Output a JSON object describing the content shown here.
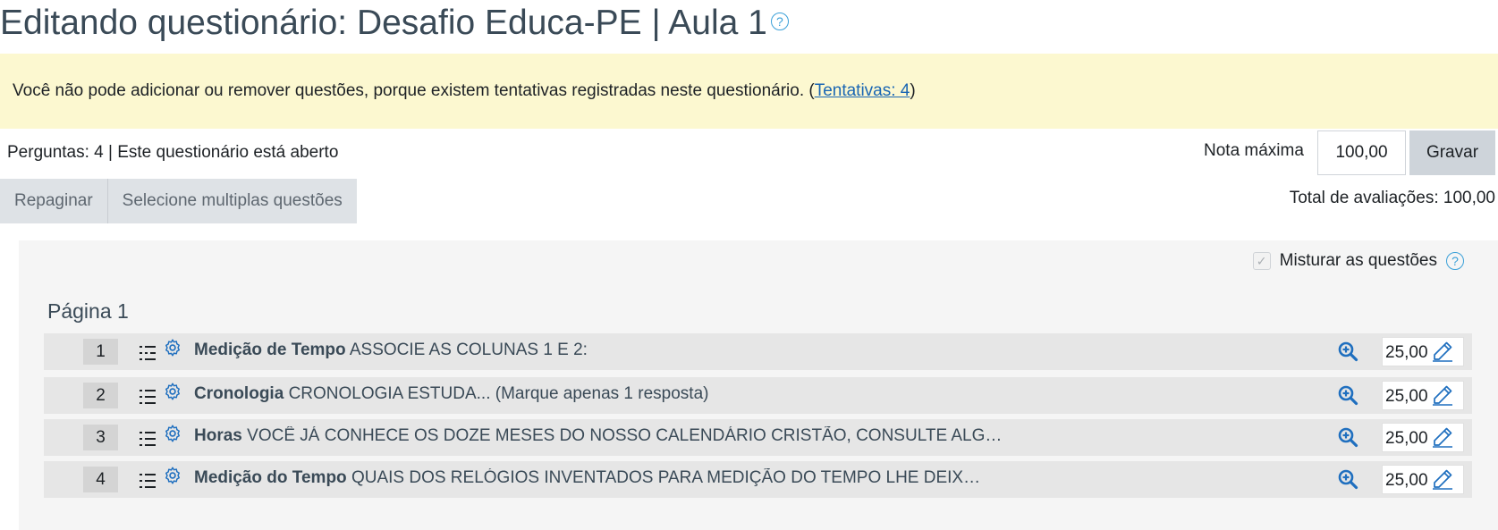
{
  "header": {
    "title": "Editando questionário: Desafio Educa-PE | Aula 1",
    "help_icon": "question-circle-icon"
  },
  "alert": {
    "message": "Você não pode adicionar ou remover questões, porque existem tentativas registradas neste questionário. (",
    "link_text": "Tentativas: 4",
    "suffix": ")"
  },
  "status": {
    "text": "Perguntas: 4 | Este questionário está aberto"
  },
  "max_grade": {
    "label": "Nota máxima",
    "value": "100,00",
    "save_label": "Gravar"
  },
  "toolbar": {
    "repaginate_label": "Repaginar",
    "select_multiple_label": "Selecione multiplas questões"
  },
  "total_grades": "Total de avaliações: 100,00",
  "shuffle": {
    "label": "Misturar as questões",
    "checked": true
  },
  "page_heading": "Página 1",
  "questions": [
    {
      "number": "1",
      "name": "Medição de Tempo",
      "text": "ASSOCIE AS COLUNAS 1 E 2:",
      "mark": "25,00",
      "type_icon": "match-icon"
    },
    {
      "number": "2",
      "name": "Cronologia",
      "text": "CRONOLOGIA ESTUDA... (Marque apenas 1 resposta)",
      "mark": "25,00",
      "type_icon": "multichoice-icon"
    },
    {
      "number": "3",
      "name": "Horas",
      "text": "VOCÊ JÁ CONHECE OS DOZE MESES DO NOSSO CALENDÁRIO CRISTÃO, CONSULTE ALG…",
      "mark": "25,00",
      "type_icon": "multichoice-icon"
    },
    {
      "number": "4",
      "name": "Medição do Tempo",
      "text": "QUAIS DOS RELÓGIOS INVENTADOS PARA MEDIÇÃO DO TEMPO LHE DEIX…",
      "mark": "25,00",
      "type_icon": "multichoice-icon"
    }
  ],
  "colors": {
    "alert_background": "#fcf8d0",
    "link": "#1a66b3",
    "icon_blue": "#1f6fbf",
    "help_blue": "#3aa0d8"
  }
}
